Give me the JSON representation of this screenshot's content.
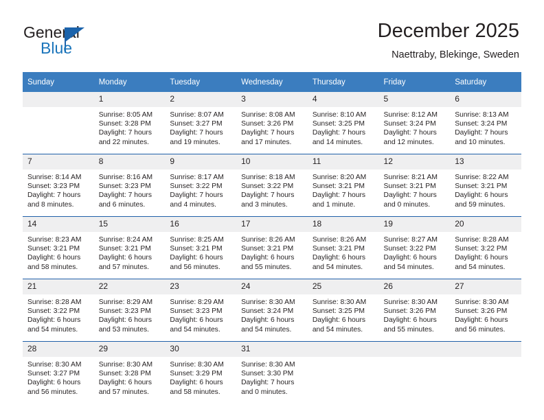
{
  "brand": {
    "name_top": "General",
    "name_bottom": "Blue",
    "triangle_color": "#1b63ab",
    "blue_color": "#1b75bb"
  },
  "header": {
    "title": "December 2025",
    "location": "Naettraby, Blekinge, Sweden"
  },
  "colors": {
    "header_row_bg": "#3b7dbf",
    "header_row_text": "#ffffff",
    "day_band_bg": "#efeff0",
    "row_separator": "#1f5fa8",
    "body_text": "#231f20"
  },
  "weekday_headers": [
    "Sunday",
    "Monday",
    "Tuesday",
    "Wednesday",
    "Thursday",
    "Friday",
    "Saturday"
  ],
  "weeks": [
    [
      {
        "day": "",
        "sunrise": "",
        "sunset": "",
        "daylight_line1": "",
        "daylight_line2": ""
      },
      {
        "day": "1",
        "sunrise": "Sunrise: 8:05 AM",
        "sunset": "Sunset: 3:28 PM",
        "daylight_line1": "Daylight: 7 hours",
        "daylight_line2": "and 22 minutes."
      },
      {
        "day": "2",
        "sunrise": "Sunrise: 8:07 AM",
        "sunset": "Sunset: 3:27 PM",
        "daylight_line1": "Daylight: 7 hours",
        "daylight_line2": "and 19 minutes."
      },
      {
        "day": "3",
        "sunrise": "Sunrise: 8:08 AM",
        "sunset": "Sunset: 3:26 PM",
        "daylight_line1": "Daylight: 7 hours",
        "daylight_line2": "and 17 minutes."
      },
      {
        "day": "4",
        "sunrise": "Sunrise: 8:10 AM",
        "sunset": "Sunset: 3:25 PM",
        "daylight_line1": "Daylight: 7 hours",
        "daylight_line2": "and 14 minutes."
      },
      {
        "day": "5",
        "sunrise": "Sunrise: 8:12 AM",
        "sunset": "Sunset: 3:24 PM",
        "daylight_line1": "Daylight: 7 hours",
        "daylight_line2": "and 12 minutes."
      },
      {
        "day": "6",
        "sunrise": "Sunrise: 8:13 AM",
        "sunset": "Sunset: 3:24 PM",
        "daylight_line1": "Daylight: 7 hours",
        "daylight_line2": "and 10 minutes."
      }
    ],
    [
      {
        "day": "7",
        "sunrise": "Sunrise: 8:14 AM",
        "sunset": "Sunset: 3:23 PM",
        "daylight_line1": "Daylight: 7 hours",
        "daylight_line2": "and 8 minutes."
      },
      {
        "day": "8",
        "sunrise": "Sunrise: 8:16 AM",
        "sunset": "Sunset: 3:23 PM",
        "daylight_line1": "Daylight: 7 hours",
        "daylight_line2": "and 6 minutes."
      },
      {
        "day": "9",
        "sunrise": "Sunrise: 8:17 AM",
        "sunset": "Sunset: 3:22 PM",
        "daylight_line1": "Daylight: 7 hours",
        "daylight_line2": "and 4 minutes."
      },
      {
        "day": "10",
        "sunrise": "Sunrise: 8:18 AM",
        "sunset": "Sunset: 3:22 PM",
        "daylight_line1": "Daylight: 7 hours",
        "daylight_line2": "and 3 minutes."
      },
      {
        "day": "11",
        "sunrise": "Sunrise: 8:20 AM",
        "sunset": "Sunset: 3:21 PM",
        "daylight_line1": "Daylight: 7 hours",
        "daylight_line2": "and 1 minute."
      },
      {
        "day": "12",
        "sunrise": "Sunrise: 8:21 AM",
        "sunset": "Sunset: 3:21 PM",
        "daylight_line1": "Daylight: 7 hours",
        "daylight_line2": "and 0 minutes."
      },
      {
        "day": "13",
        "sunrise": "Sunrise: 8:22 AM",
        "sunset": "Sunset: 3:21 PM",
        "daylight_line1": "Daylight: 6 hours",
        "daylight_line2": "and 59 minutes."
      }
    ],
    [
      {
        "day": "14",
        "sunrise": "Sunrise: 8:23 AM",
        "sunset": "Sunset: 3:21 PM",
        "daylight_line1": "Daylight: 6 hours",
        "daylight_line2": "and 58 minutes."
      },
      {
        "day": "15",
        "sunrise": "Sunrise: 8:24 AM",
        "sunset": "Sunset: 3:21 PM",
        "daylight_line1": "Daylight: 6 hours",
        "daylight_line2": "and 57 minutes."
      },
      {
        "day": "16",
        "sunrise": "Sunrise: 8:25 AM",
        "sunset": "Sunset: 3:21 PM",
        "daylight_line1": "Daylight: 6 hours",
        "daylight_line2": "and 56 minutes."
      },
      {
        "day": "17",
        "sunrise": "Sunrise: 8:26 AM",
        "sunset": "Sunset: 3:21 PM",
        "daylight_line1": "Daylight: 6 hours",
        "daylight_line2": "and 55 minutes."
      },
      {
        "day": "18",
        "sunrise": "Sunrise: 8:26 AM",
        "sunset": "Sunset: 3:21 PM",
        "daylight_line1": "Daylight: 6 hours",
        "daylight_line2": "and 54 minutes."
      },
      {
        "day": "19",
        "sunrise": "Sunrise: 8:27 AM",
        "sunset": "Sunset: 3:22 PM",
        "daylight_line1": "Daylight: 6 hours",
        "daylight_line2": "and 54 minutes."
      },
      {
        "day": "20",
        "sunrise": "Sunrise: 8:28 AM",
        "sunset": "Sunset: 3:22 PM",
        "daylight_line1": "Daylight: 6 hours",
        "daylight_line2": "and 54 minutes."
      }
    ],
    [
      {
        "day": "21",
        "sunrise": "Sunrise: 8:28 AM",
        "sunset": "Sunset: 3:22 PM",
        "daylight_line1": "Daylight: 6 hours",
        "daylight_line2": "and 54 minutes."
      },
      {
        "day": "22",
        "sunrise": "Sunrise: 8:29 AM",
        "sunset": "Sunset: 3:23 PM",
        "daylight_line1": "Daylight: 6 hours",
        "daylight_line2": "and 53 minutes."
      },
      {
        "day": "23",
        "sunrise": "Sunrise: 8:29 AM",
        "sunset": "Sunset: 3:23 PM",
        "daylight_line1": "Daylight: 6 hours",
        "daylight_line2": "and 54 minutes."
      },
      {
        "day": "24",
        "sunrise": "Sunrise: 8:30 AM",
        "sunset": "Sunset: 3:24 PM",
        "daylight_line1": "Daylight: 6 hours",
        "daylight_line2": "and 54 minutes."
      },
      {
        "day": "25",
        "sunrise": "Sunrise: 8:30 AM",
        "sunset": "Sunset: 3:25 PM",
        "daylight_line1": "Daylight: 6 hours",
        "daylight_line2": "and 54 minutes."
      },
      {
        "day": "26",
        "sunrise": "Sunrise: 8:30 AM",
        "sunset": "Sunset: 3:26 PM",
        "daylight_line1": "Daylight: 6 hours",
        "daylight_line2": "and 55 minutes."
      },
      {
        "day": "27",
        "sunrise": "Sunrise: 8:30 AM",
        "sunset": "Sunset: 3:26 PM",
        "daylight_line1": "Daylight: 6 hours",
        "daylight_line2": "and 56 minutes."
      }
    ],
    [
      {
        "day": "28",
        "sunrise": "Sunrise: 8:30 AM",
        "sunset": "Sunset: 3:27 PM",
        "daylight_line1": "Daylight: 6 hours",
        "daylight_line2": "and 56 minutes."
      },
      {
        "day": "29",
        "sunrise": "Sunrise: 8:30 AM",
        "sunset": "Sunset: 3:28 PM",
        "daylight_line1": "Daylight: 6 hours",
        "daylight_line2": "and 57 minutes."
      },
      {
        "day": "30",
        "sunrise": "Sunrise: 8:30 AM",
        "sunset": "Sunset: 3:29 PM",
        "daylight_line1": "Daylight: 6 hours",
        "daylight_line2": "and 58 minutes."
      },
      {
        "day": "31",
        "sunrise": "Sunrise: 8:30 AM",
        "sunset": "Sunset: 3:30 PM",
        "daylight_line1": "Daylight: 7 hours",
        "daylight_line2": "and 0 minutes."
      },
      {
        "day": "",
        "sunrise": "",
        "sunset": "",
        "daylight_line1": "",
        "daylight_line2": ""
      },
      {
        "day": "",
        "sunrise": "",
        "sunset": "",
        "daylight_line1": "",
        "daylight_line2": ""
      },
      {
        "day": "",
        "sunrise": "",
        "sunset": "",
        "daylight_line1": "",
        "daylight_line2": ""
      }
    ]
  ]
}
